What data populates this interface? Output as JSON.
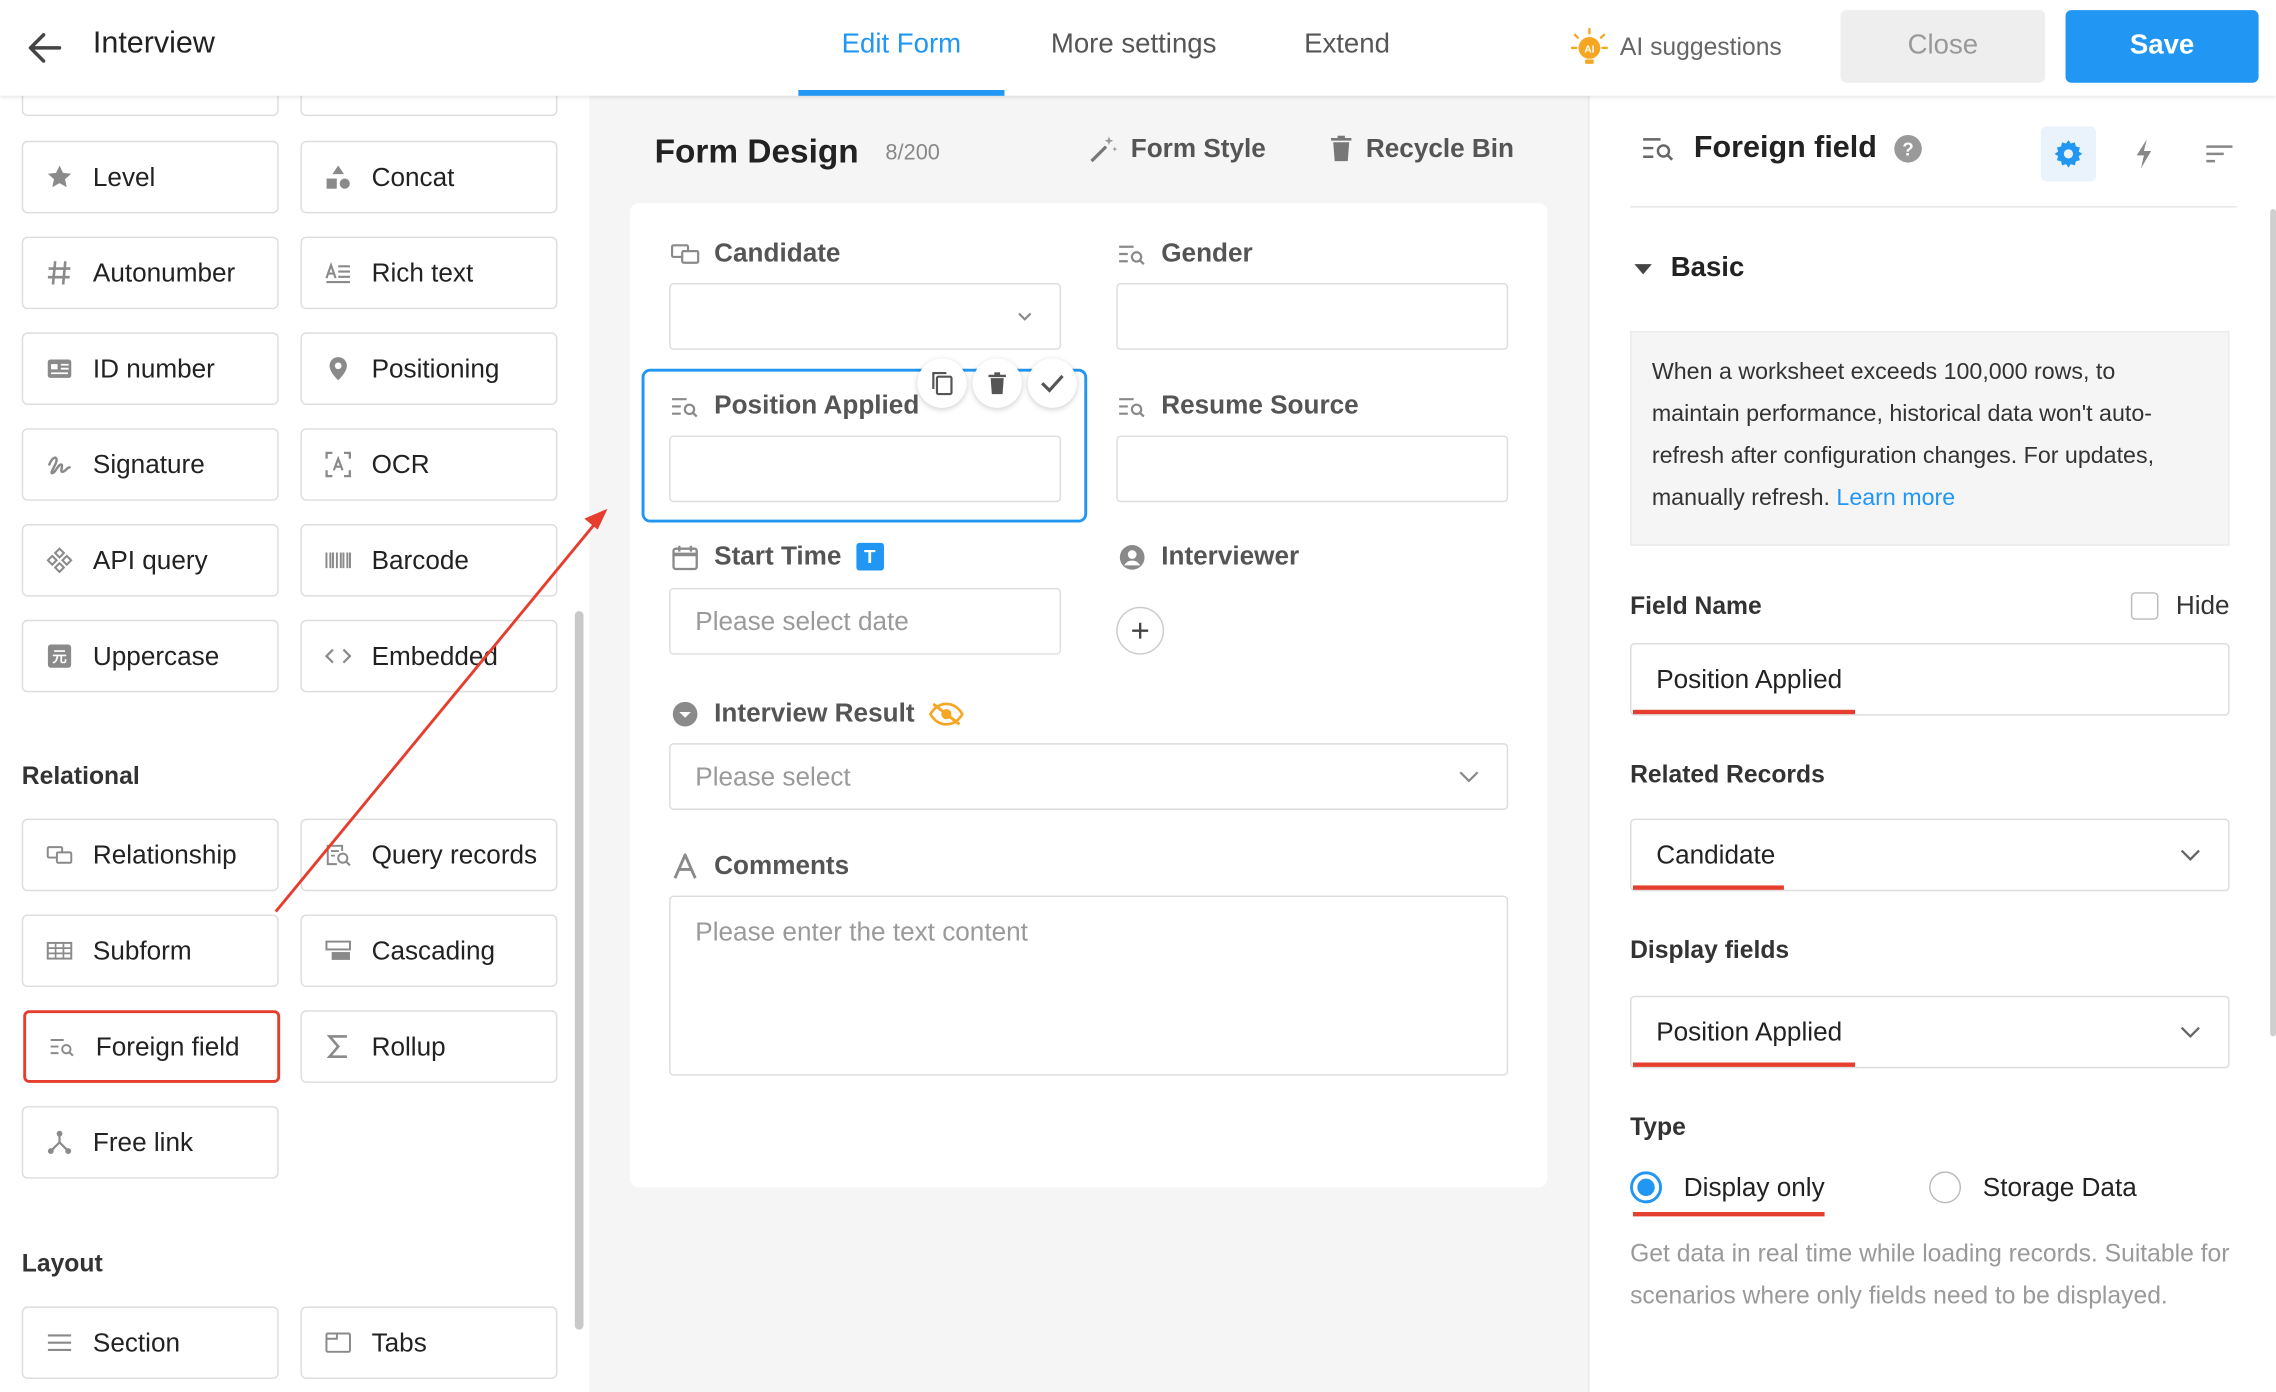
{
  "header": {
    "back_icon": "arrow-left-icon",
    "title": "Interview",
    "tabs": [
      {
        "label": "Edit Form",
        "active": true
      },
      {
        "label": "More settings",
        "active": false
      },
      {
        "label": "Extend",
        "active": false
      }
    ],
    "ai_label": "AI suggestions",
    "ai_icon": "ai-bulb-icon",
    "close_label": "Close",
    "save_label": "Save",
    "accent": "#2196f3"
  },
  "left": {
    "controls": [
      {
        "label": "Level",
        "icon": "star-icon"
      },
      {
        "label": "Concat",
        "icon": "shapes-icon"
      },
      {
        "label": "Autonumber",
        "icon": "hash-icon"
      },
      {
        "label": "Rich text",
        "icon": "rich-text-icon"
      },
      {
        "label": "ID number",
        "icon": "id-card-icon"
      },
      {
        "label": "Positioning",
        "icon": "map-pin-icon"
      },
      {
        "label": "Signature",
        "icon": "signature-icon"
      },
      {
        "label": "OCR",
        "icon": "ocr-scan-icon"
      },
      {
        "label": "API query",
        "icon": "api-icon"
      },
      {
        "label": "Barcode",
        "icon": "barcode-icon"
      },
      {
        "label": "Uppercase",
        "icon": "uppercase-icon"
      },
      {
        "label": "Embedded",
        "icon": "code-brackets-icon"
      }
    ],
    "relational_title": "Relational",
    "relational": [
      {
        "label": "Relationship",
        "icon": "relationship-icon"
      },
      {
        "label": "Query records",
        "icon": "query-records-icon"
      },
      {
        "label": "Subform",
        "icon": "table-grid-icon"
      },
      {
        "label": "Cascading",
        "icon": "cascading-icon"
      },
      {
        "label": "Foreign field",
        "icon": "foreign-field-icon",
        "selected": true
      },
      {
        "label": "Rollup",
        "icon": "sigma-icon"
      },
      {
        "label": "Free link",
        "icon": "free-link-icon"
      }
    ],
    "layout_title": "Layout",
    "layout": [
      {
        "label": "Section",
        "icon": "menu-lines-icon"
      },
      {
        "label": "Tabs",
        "icon": "tabs-window-icon"
      }
    ]
  },
  "form": {
    "title": "Form Design",
    "count": "8/200",
    "style_label": "Form Style",
    "recycle_label": "Recycle Bin",
    "fields": {
      "candidate": {
        "label": "Candidate",
        "icon": "relationship-icon",
        "value": ""
      },
      "gender": {
        "label": "Gender",
        "icon": "foreign-field-icon",
        "value": ""
      },
      "position_applied": {
        "label": "Position Applied",
        "icon": "foreign-field-icon",
        "value": ""
      },
      "resume_source": {
        "label": "Resume Source",
        "icon": "foreign-field-icon",
        "value": ""
      },
      "start_time": {
        "label": "Start Time",
        "icon": "calendar-icon",
        "badge": "T",
        "placeholder": "Please select date"
      },
      "interviewer": {
        "label": "Interviewer",
        "icon": "user-circle-icon"
      },
      "interview_result": {
        "label": "Interview Result",
        "icon": "dropdown-circle-icon",
        "hidden_icon": "eye-off-icon",
        "placeholder": "Please select"
      },
      "comments": {
        "label": "Comments",
        "icon": "text-a-icon",
        "placeholder": "Please enter the text content"
      }
    }
  },
  "right": {
    "title": "Foreign field",
    "help": "?",
    "basic_label": "Basic",
    "note": "When a worksheet exceeds 100,000 rows, to maintain performance, historical data won't auto-refresh after configuration changes. For updates, manually refresh.",
    "learn_more": "Learn more",
    "field_name_label": "Field Name",
    "hide_label": "Hide",
    "field_name_value": "Position Applied",
    "related_label": "Related Records",
    "related_value": "Candidate",
    "display_label": "Display fields",
    "display_value": "Position Applied",
    "type_label": "Type",
    "type_options": [
      {
        "label": "Display only",
        "checked": true
      },
      {
        "label": "Storage Data",
        "checked": false
      }
    ],
    "hint": "Get data in real time while loading records. Suitable for scenarios where only fields need to be displayed.",
    "annotation_color": "#e53e2e"
  }
}
